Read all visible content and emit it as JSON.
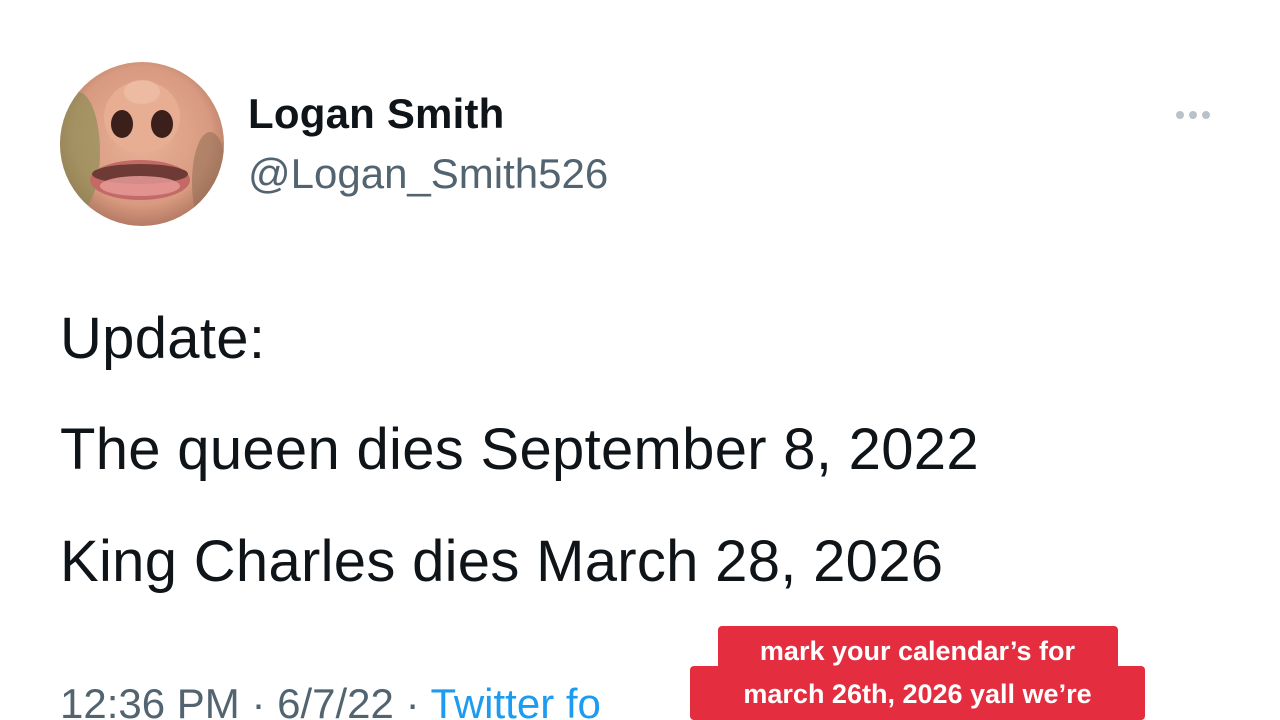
{
  "author": {
    "display_name": "Logan Smith",
    "handle": "@Logan_Smith526"
  },
  "tweet": {
    "lines": [
      "Update:",
      "The queen dies September 8, 2022",
      "King Charles dies March 28, 2026"
    ],
    "time": "12:36 PM",
    "separator": "·",
    "date": "6/7/22",
    "source": "Twitter fo"
  },
  "caption": {
    "line_1": "mark your calendar’s for",
    "line_2": "march 26th, 2026 yall we’re",
    "color": "#e42d3f"
  },
  "icons": {
    "more": "more-horizontal-icon"
  }
}
